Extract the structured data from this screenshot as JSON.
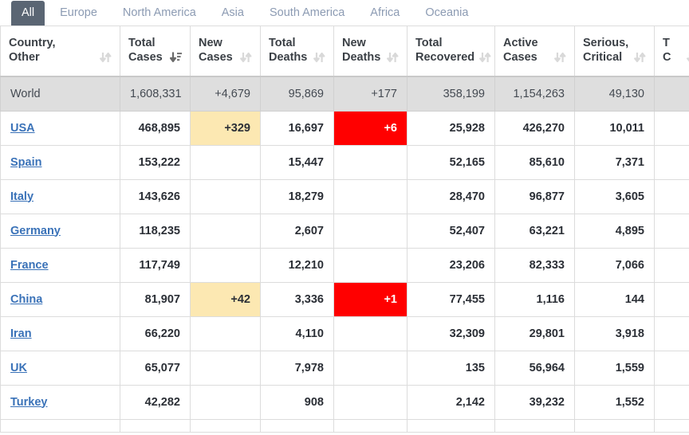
{
  "tabs": [
    {
      "label": "All",
      "active": true
    },
    {
      "label": "Europe",
      "active": false
    },
    {
      "label": "North America",
      "active": false
    },
    {
      "label": "Asia",
      "active": false
    },
    {
      "label": "South America",
      "active": false
    },
    {
      "label": "Africa",
      "active": false
    },
    {
      "label": "Oceania",
      "active": false
    }
  ],
  "table": {
    "columns": [
      {
        "line1": "Country,",
        "line2": "Other",
        "sort": "none",
        "icon": "sort-both-icon"
      },
      {
        "line1": "Total",
        "line2": "Cases",
        "sort": "desc",
        "icon": "sort-desc-icon"
      },
      {
        "line1": "New",
        "line2": "Cases",
        "sort": "none",
        "icon": "sort-both-icon"
      },
      {
        "line1": "Total",
        "line2": "Deaths",
        "sort": "none",
        "icon": "sort-both-icon"
      },
      {
        "line1": "New",
        "line2": "Deaths",
        "sort": "none",
        "icon": "sort-both-icon"
      },
      {
        "line1": "Total",
        "line2": "Recovered",
        "sort": "none",
        "icon": "sort-both-icon"
      },
      {
        "line1": "Active",
        "line2": "Cases",
        "sort": "none",
        "icon": "sort-both-icon"
      },
      {
        "line1": "Serious,",
        "line2": "Critical",
        "sort": "none",
        "icon": "sort-both-icon"
      },
      {
        "line1": "T",
        "line2": "C",
        "sort": "none",
        "icon": "sort-both-icon"
      }
    ],
    "rows": [
      {
        "type": "world",
        "country": "World",
        "link": false,
        "total_cases": "1,608,331",
        "new_cases": "+4,679",
        "total_deaths": "95,869",
        "new_deaths": "+177",
        "total_recovered": "358,199",
        "active_cases": "1,154,263",
        "serious_critical": "49,130",
        "extra": "",
        "new_cases_hl": "none",
        "new_deaths_hl": "none"
      },
      {
        "type": "data",
        "country": "USA",
        "link": true,
        "total_cases": "468,895",
        "new_cases": "+329",
        "total_deaths": "16,697",
        "new_deaths": "+6",
        "total_recovered": "25,928",
        "active_cases": "426,270",
        "serious_critical": "10,011",
        "extra": "",
        "new_cases_hl": "yellow",
        "new_deaths_hl": "red"
      },
      {
        "type": "data",
        "country": "Spain",
        "link": true,
        "total_cases": "153,222",
        "new_cases": "",
        "total_deaths": "15,447",
        "new_deaths": "",
        "total_recovered": "52,165",
        "active_cases": "85,610",
        "serious_critical": "7,371",
        "extra": "",
        "new_cases_hl": "none",
        "new_deaths_hl": "none"
      },
      {
        "type": "data",
        "country": "Italy",
        "link": true,
        "total_cases": "143,626",
        "new_cases": "",
        "total_deaths": "18,279",
        "new_deaths": "",
        "total_recovered": "28,470",
        "active_cases": "96,877",
        "serious_critical": "3,605",
        "extra": "",
        "new_cases_hl": "none",
        "new_deaths_hl": "none"
      },
      {
        "type": "data",
        "country": "Germany",
        "link": true,
        "total_cases": "118,235",
        "new_cases": "",
        "total_deaths": "2,607",
        "new_deaths": "",
        "total_recovered": "52,407",
        "active_cases": "63,221",
        "serious_critical": "4,895",
        "extra": "",
        "new_cases_hl": "none",
        "new_deaths_hl": "none"
      },
      {
        "type": "data",
        "country": "France",
        "link": true,
        "total_cases": "117,749",
        "new_cases": "",
        "total_deaths": "12,210",
        "new_deaths": "",
        "total_recovered": "23,206",
        "active_cases": "82,333",
        "serious_critical": "7,066",
        "extra": "",
        "new_cases_hl": "none",
        "new_deaths_hl": "none"
      },
      {
        "type": "data",
        "country": "China",
        "link": true,
        "total_cases": "81,907",
        "new_cases": "+42",
        "total_deaths": "3,336",
        "new_deaths": "+1",
        "total_recovered": "77,455",
        "active_cases": "1,116",
        "serious_critical": "144",
        "extra": "",
        "new_cases_hl": "yellow",
        "new_deaths_hl": "red"
      },
      {
        "type": "data",
        "country": "Iran",
        "link": true,
        "total_cases": "66,220",
        "new_cases": "",
        "total_deaths": "4,110",
        "new_deaths": "",
        "total_recovered": "32,309",
        "active_cases": "29,801",
        "serious_critical": "3,918",
        "extra": "",
        "new_cases_hl": "none",
        "new_deaths_hl": "none"
      },
      {
        "type": "data",
        "country": "UK",
        "link": true,
        "total_cases": "65,077",
        "new_cases": "",
        "total_deaths": "7,978",
        "new_deaths": "",
        "total_recovered": "135",
        "active_cases": "56,964",
        "serious_critical": "1,559",
        "extra": "",
        "new_cases_hl": "none",
        "new_deaths_hl": "none"
      },
      {
        "type": "data",
        "country": "Turkey",
        "link": true,
        "total_cases": "42,282",
        "new_cases": "",
        "total_deaths": "908",
        "new_deaths": "",
        "total_recovered": "2,142",
        "active_cases": "39,232",
        "serious_critical": "1,552",
        "extra": "",
        "new_cases_hl": "none",
        "new_deaths_hl": "none"
      },
      {
        "type": "partial",
        "country": "",
        "link": true,
        "total_cases": "",
        "new_cases": "",
        "total_deaths": "",
        "new_deaths": "",
        "total_recovered": "",
        "active_cases": "",
        "serious_critical": "",
        "extra": "",
        "new_cases_hl": "none",
        "new_deaths_hl": "none"
      }
    ]
  },
  "colors": {
    "tab_active_bg": "#5a6573",
    "tab_inactive_text": "#8c9bb3",
    "link": "#3a72b8",
    "world_row_bg": "#dedede",
    "highlight_yellow": "#fce8b2",
    "highlight_red": "#ff0000",
    "border": "#dcdcdc"
  }
}
